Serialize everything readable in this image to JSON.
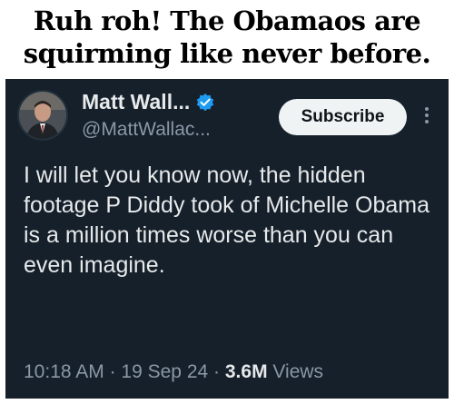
{
  "caption": {
    "line1": "Ruh roh! The Obamaos are",
    "line2": "squirming like never before."
  },
  "tweet": {
    "display_name": "Matt Wall...",
    "handle": "@MattWallac...",
    "subscribe_label": "Subscribe",
    "text": "I will let you know now, the hidden footage P Diddy took of Michelle Obama is a million times worse than you can even imagine.",
    "time": "10:18 AM",
    "separator": "·",
    "date": "19 Sep 24",
    "views_count": "3.6M",
    "views_label": "Views"
  },
  "colors": {
    "background": "#15202b",
    "text_primary": "#e7e9ea",
    "text_secondary": "#8b98a5",
    "verified": "#1d9bf0",
    "button_bg": "#eff3f4"
  },
  "icons": {
    "verified": "verified-badge-icon",
    "more": "more-options-icon"
  }
}
